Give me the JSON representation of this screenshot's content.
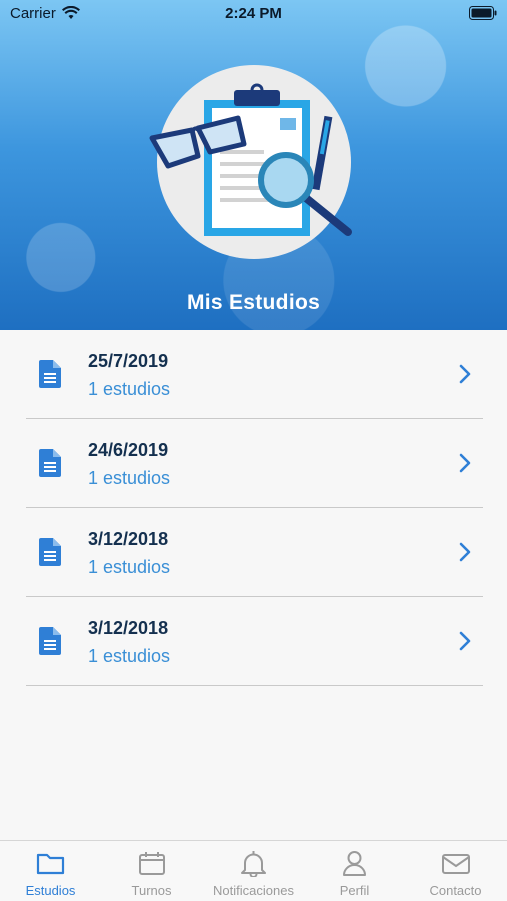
{
  "status_bar": {
    "carrier": "Carrier",
    "time": "2:24 PM"
  },
  "header": {
    "title": "Mis Estudios"
  },
  "studies": [
    {
      "date": "25/7/2019",
      "count": "1 estudios"
    },
    {
      "date": "24/6/2019",
      "count": "1 estudios"
    },
    {
      "date": "3/12/2018",
      "count": "1 estudios"
    },
    {
      "date": "3/12/2018",
      "count": "1 estudios"
    }
  ],
  "tabs": [
    {
      "label": "Estudios",
      "icon": "folder-icon",
      "active": true
    },
    {
      "label": "Turnos",
      "icon": "calendar-icon",
      "active": false
    },
    {
      "label": "Notificaciones",
      "icon": "bell-icon",
      "active": false
    },
    {
      "label": "Perfil",
      "icon": "person-icon",
      "active": false
    },
    {
      "label": "Contacto",
      "icon": "envelope-icon",
      "active": false
    }
  ],
  "colors": {
    "accent": "#2f7fd6",
    "date_text": "#14304f",
    "count_text": "#3a8fd6",
    "tab_inactive": "#9a9a9a"
  }
}
